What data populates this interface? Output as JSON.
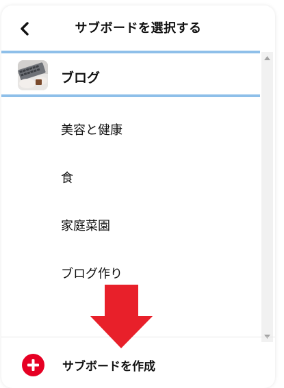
{
  "header": {
    "title": "サブボードを選択する",
    "back_icon": "chevron-left-icon"
  },
  "list": {
    "selected": {
      "label": "ブログ",
      "thumbnail": "keyboard-photo"
    },
    "items": [
      {
        "label": "美容と健康"
      },
      {
        "label": "食"
      },
      {
        "label": "家庭菜園"
      },
      {
        "label": "ブログ作り"
      }
    ]
  },
  "footer": {
    "create_label": "サブボードを作成",
    "icon": "plus-icon"
  },
  "colors": {
    "selection_border": "#8ebfe9",
    "accent": "#e60023",
    "annotation": "#e8202a"
  }
}
